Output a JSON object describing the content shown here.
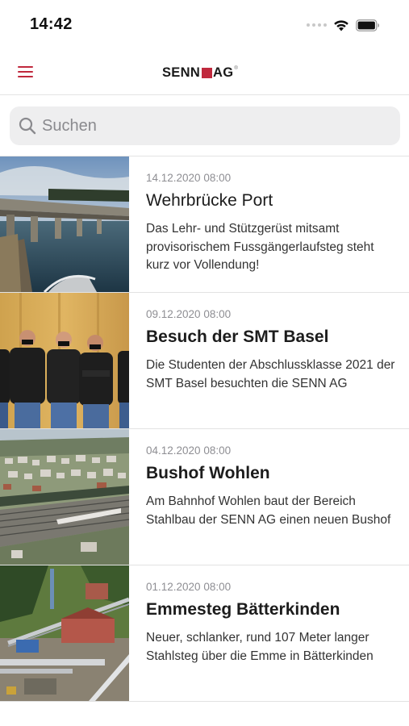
{
  "status_bar": {
    "time": "14:42",
    "icons": [
      "signal-dots-icon",
      "wifi-icon",
      "battery-icon"
    ]
  },
  "nav": {
    "menu_icon": "hamburger-menu-icon",
    "logo_left": "SENN",
    "logo_right": "AG",
    "logo_reg": "®",
    "accent_color": "#c0293d"
  },
  "search": {
    "placeholder": "Suchen",
    "value": "",
    "icon": "search-icon"
  },
  "news": [
    {
      "date": "14.12.2020 08:00",
      "title": "Wehrbrücke Port",
      "title_bold": false,
      "description": "Das Lehr- und Stützgerüst mitsamt provisorischem Fussgängerlaufsteg steht kurz vor Vollendung!",
      "thumbnail": "bridge-photo"
    },
    {
      "date": "09.12.2020 08:00",
      "title": "Besuch der SMT Basel",
      "title_bold": true,
      "description": "Die Studenten der Abschlussklasse 2021 der SMT Basel besuchten die SENN AG",
      "thumbnail": "students-photo"
    },
    {
      "date": "04.12.2020 08:00",
      "title": "Bushof Wohlen",
      "title_bold": true,
      "description": "Am Bahnhof Wohlen baut der Bereich Stahlbau der SENN AG einen neuen Bushof",
      "thumbnail": "aerial-town-photo"
    },
    {
      "date": "01.12.2020 08:00",
      "title": "Emmesteg Bätterkinden",
      "title_bold": true,
      "description": "Neuer, schlanker, rund 107 Meter langer Stahlsteg über die Emme in Bätterkinden",
      "thumbnail": "construction-crane-photo"
    }
  ]
}
